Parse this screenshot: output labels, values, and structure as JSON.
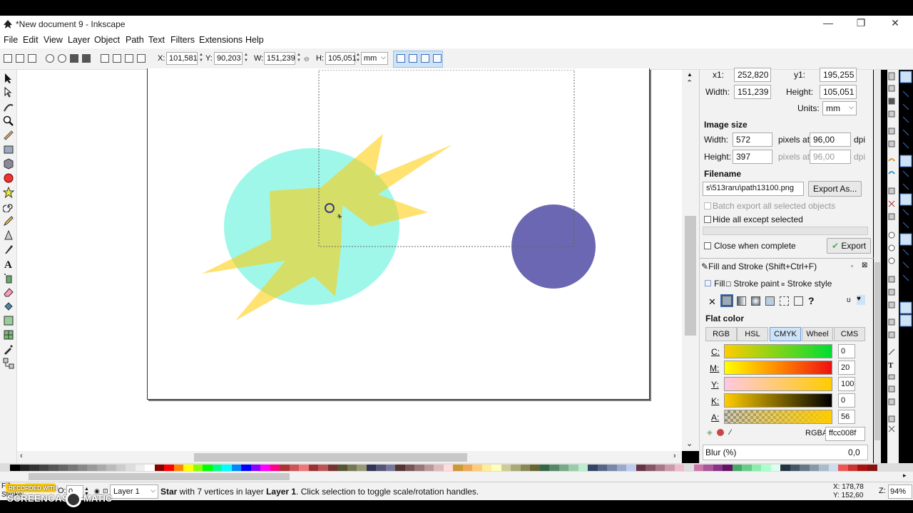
{
  "window": {
    "title": "*New document 9 - Inkscape",
    "minimize": "—",
    "restore": "❐",
    "close": "✕"
  },
  "menu": [
    "File",
    "Edit",
    "View",
    "Layer",
    "Object",
    "Path",
    "Text",
    "Filters",
    "Extensions",
    "Help"
  ],
  "toolctrl": {
    "x_label": "X:",
    "x_value": "101,581",
    "y_label": "Y:",
    "y_value": "90,203",
    "w_label": "W:",
    "w_value": "151,239",
    "h_label": "H:",
    "h_value": "105,051",
    "unit": "mm"
  },
  "export": {
    "x1_label": "x1:",
    "x1_value": "252,820",
    "y1_label": "y1:",
    "y1_value": "195,255",
    "width_label": "Width:",
    "width_value": "151,239",
    "height_label": "Height:",
    "height_value": "105,051",
    "units_label": "Units:",
    "units_value": "mm",
    "image_size_title": "Image size",
    "img_width_label": "Width:",
    "img_width_value": "572",
    "img_height_label": "Height:",
    "img_height_value": "397",
    "pixels_at": "pixels at",
    "dpi_value": "96,00",
    "dpi_value2": "96,00",
    "dpi": "dpi",
    "filename_title": "Filename",
    "filename_value": "s\\513raru\\path13100.png",
    "export_as": "Export As...",
    "batch_export": "Batch export all selected objects",
    "hide_all": "Hide all except selected",
    "close_when_complete": "Close when complete",
    "export_button": "Export"
  },
  "fill_stroke": {
    "title": "Fill and Stroke (Shift+Ctrl+F)",
    "tab_fill": "Fill",
    "tab_stroke_paint": "Stroke paint",
    "tab_stroke_style": "Stroke style",
    "flat_color": "Flat color",
    "modes": [
      "RGB",
      "HSL",
      "CMYK",
      "Wheel",
      "CMS"
    ],
    "active_mode": "CMYK",
    "channels": [
      {
        "label": "C:",
        "value": "0"
      },
      {
        "label": "M:",
        "value": "20"
      },
      {
        "label": "Y:",
        "value": "100"
      },
      {
        "label": "K:",
        "value": "0"
      },
      {
        "label": "A:",
        "value": "56"
      }
    ],
    "rgba_label": "RGBA:",
    "rgba_value": "ffcc008f",
    "blur_label": "Blur (%)",
    "blur_value": "0,0"
  },
  "status": {
    "fill_label": "Fill:",
    "stroke_label": "Stroke:",
    "opacity_label": "O:",
    "opacity_value": "0",
    "layer": "Layer 1",
    "message_bold": "Star",
    "message_rest": " with 7 vertices in layer ",
    "message_layer": "Layer 1",
    "message_tail": ". Click selection to toggle scale/rotation handles.",
    "coord_x": "X: 178,78",
    "coord_y": "Y: 152,60",
    "zoom_label": "Z:",
    "zoom_value": "94%"
  },
  "watermark": {
    "recorded_with": "RECORDED WITH",
    "brand": "SCREENCAST",
    "brand2": "MATIC"
  },
  "colors": {
    "circle_cyan": "#9ff7ea",
    "star_yellow": "#ffcc00",
    "circle_purple": "#6b67b2"
  }
}
